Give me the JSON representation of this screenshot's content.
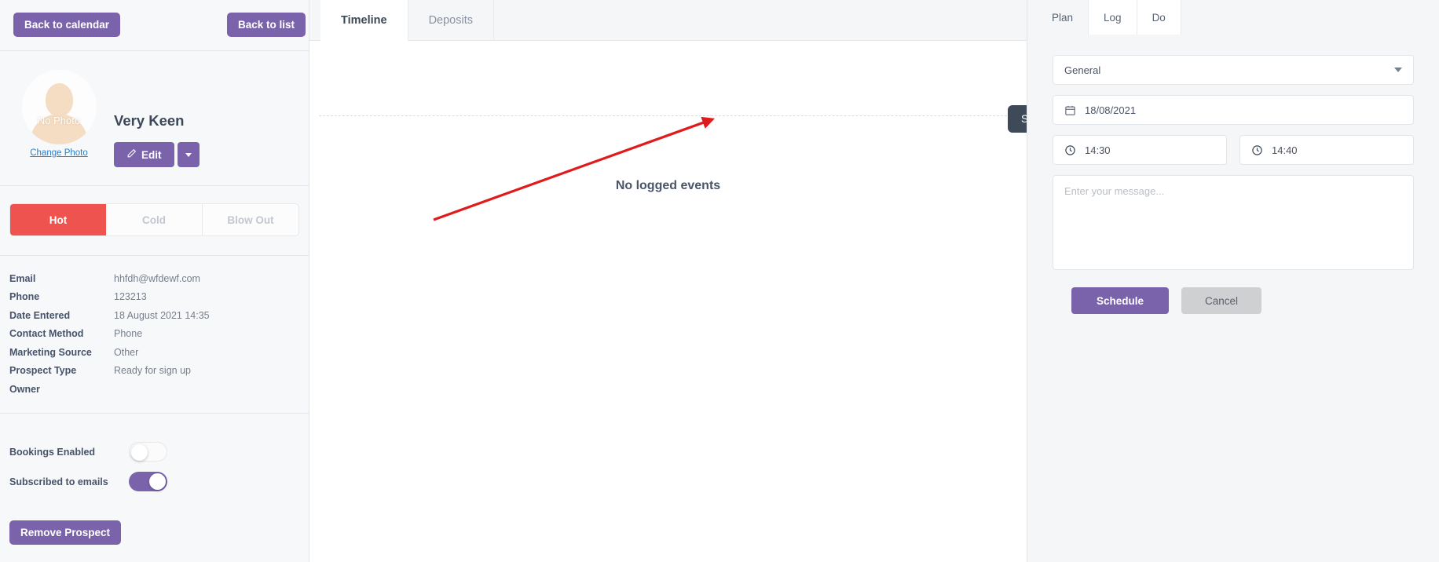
{
  "sidebar": {
    "back_to_calendar": "Back to calendar",
    "back_to_list": "Back to list",
    "avatar_placeholder_text": "No Photo",
    "change_photo": "Change Photo",
    "prospect_name": "Very Keen",
    "edit_label": "Edit",
    "status_segments": [
      {
        "label": "Hot",
        "active": true
      },
      {
        "label": "Cold",
        "active": false
      },
      {
        "label": "Blow Out",
        "active": false
      }
    ],
    "details": [
      {
        "label": "Email",
        "value": "hhfdh@wfdewf.com"
      },
      {
        "label": "Phone",
        "value": "123213"
      },
      {
        "label": "Date Entered",
        "value": "18 August 2021 14:35"
      },
      {
        "label": "Contact Method",
        "value": "Phone"
      },
      {
        "label": "Marketing Source",
        "value": "Other"
      },
      {
        "label": "Prospect Type",
        "value": "Ready for sign up"
      },
      {
        "label": "Owner",
        "value": ""
      }
    ],
    "toggles": [
      {
        "label": "Bookings Enabled",
        "on": false
      },
      {
        "label": "Subscribed to emails",
        "on": true
      }
    ],
    "remove_prospect": "Remove Prospect"
  },
  "center": {
    "tabs": [
      {
        "label": "Timeline",
        "active": true
      },
      {
        "label": "Deposits",
        "active": false
      }
    ],
    "empty_state": "No logged events",
    "tooltip": "Sign up this prospect"
  },
  "right_panel": {
    "tabs": [
      {
        "label": "Plan",
        "active": true
      },
      {
        "label": "Log",
        "active": false
      },
      {
        "label": "Do",
        "active": false
      }
    ],
    "category_value": "General",
    "date_value": "18/08/2021",
    "time_start": "14:30",
    "time_end": "14:40",
    "message_placeholder": "Enter your message...",
    "schedule_label": "Schedule",
    "cancel_label": "Cancel"
  },
  "colors": {
    "purple": "#7b63ac",
    "hot_red": "#ef5350",
    "tooltip_bg": "#3e4a57",
    "annotation_red": "#e01b1b",
    "link_blue": "#2a7fc9"
  }
}
